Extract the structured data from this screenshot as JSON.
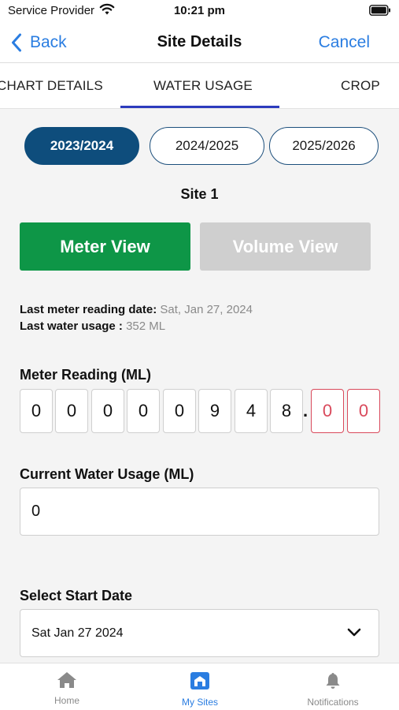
{
  "status_bar": {
    "carrier": "Service Provider",
    "time": "10:21 pm"
  },
  "nav": {
    "back_label": "Back",
    "title": "Site Details",
    "cancel_label": "Cancel"
  },
  "tabs": [
    {
      "label": "CHART DETAILS"
    },
    {
      "label": "WATER USAGE",
      "active": true
    },
    {
      "label": "CROP"
    }
  ],
  "years": [
    {
      "label": "2023/2024",
      "active": true
    },
    {
      "label": "2024/2025"
    },
    {
      "label": "2025/2026"
    }
  ],
  "site_name": "Site 1",
  "views": {
    "meter_label": "Meter View",
    "volume_label": "Volume View"
  },
  "info": {
    "last_reading_label": "Last meter reading date:",
    "last_reading_value": "Sat, Jan 27, 2024",
    "last_usage_label": "Last water usage :",
    "last_usage_value": "352 ML"
  },
  "meter": {
    "label": "Meter Reading (ML)",
    "digits": [
      "0",
      "0",
      "0",
      "0",
      "0",
      "9",
      "4",
      "8"
    ],
    "separator": ".",
    "decimals": [
      "0",
      "0"
    ]
  },
  "usage": {
    "label": "Current Water Usage (ML)",
    "value": "0"
  },
  "start_date": {
    "label": "Select Start Date",
    "value": "Sat Jan 27 2024"
  },
  "bottom_nav": [
    {
      "label": "Home",
      "icon": "home-icon"
    },
    {
      "label": "My Sites",
      "icon": "my-sites-icon",
      "active": true
    },
    {
      "label": "Notifications",
      "icon": "bell-icon"
    }
  ],
  "colors": {
    "accent_blue": "#2a7de1",
    "year_active": "#0e4d7c",
    "meter_green": "#0e9647",
    "volume_grey": "#cfcfcf",
    "decimal_red": "#d9495b",
    "tab_indicator": "#2c3bbd"
  }
}
